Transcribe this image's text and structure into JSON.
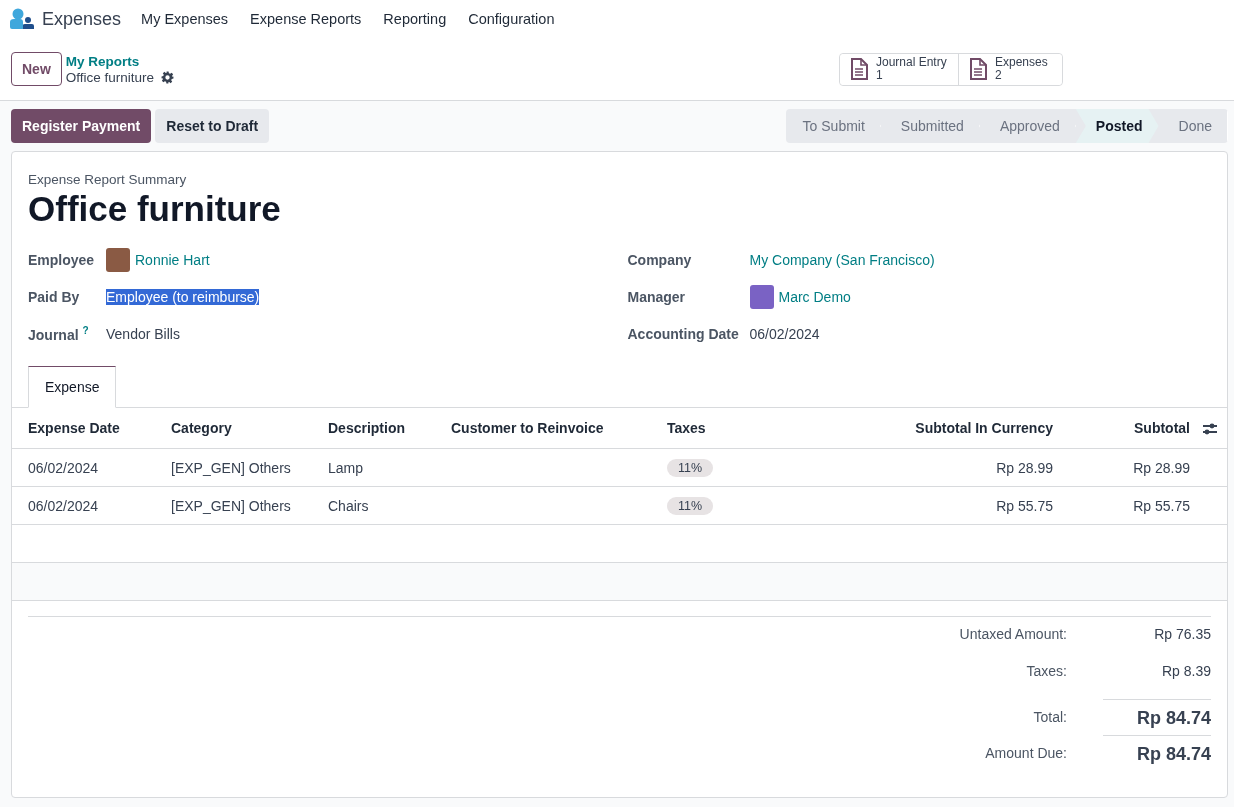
{
  "app": {
    "name": "Expenses"
  },
  "menu": [
    "My Expenses",
    "Expense Reports",
    "Reporting",
    "Configuration"
  ],
  "new_button": "New",
  "breadcrumb": {
    "parent": "My Reports",
    "current": "Office furniture"
  },
  "smart_buttons": [
    {
      "label": "Journal Entry",
      "count": "1"
    },
    {
      "label": "Expenses",
      "count": "2"
    }
  ],
  "actions": [
    {
      "label": "Register Payment",
      "primary": true
    },
    {
      "label": "Reset to Draft",
      "primary": false
    }
  ],
  "stages": [
    {
      "label": "To Submit",
      "selected": false
    },
    {
      "label": "Submitted",
      "selected": false
    },
    {
      "label": "Approved",
      "selected": false
    },
    {
      "label": "Posted",
      "selected": true
    },
    {
      "label": "Done",
      "selected": false
    }
  ],
  "form": {
    "subtitle": "Expense Report Summary",
    "title": "Office furniture",
    "fields_left": [
      {
        "label": "Employee",
        "value": "Ronnie Hart",
        "kind": "avatar-link"
      },
      {
        "label": "Paid By",
        "value": "Employee (to reimburse)",
        "kind": "selected-text"
      },
      {
        "label": "Journal",
        "value": "Vendor Bills",
        "kind": "text",
        "help": "?"
      }
    ],
    "fields_right": [
      {
        "label": "Company",
        "value": "My Company (San Francisco)",
        "kind": "link"
      },
      {
        "label": "Manager",
        "value": "Marc Demo",
        "kind": "avatar-link"
      },
      {
        "label": "Accounting Date",
        "value": "06/02/2024",
        "kind": "text"
      }
    ]
  },
  "tabs": [
    {
      "label": "Expense",
      "selected": true
    }
  ],
  "table": {
    "columns": [
      "Expense Date",
      "Category",
      "Description",
      "Customer to Reinvoice",
      "Taxes",
      "Subtotal In Currency",
      "Subtotal"
    ],
    "rows": [
      {
        "expense_date": "06/02/2024",
        "category": "[EXP_GEN] Others",
        "description": "Lamp",
        "taxes": "11%",
        "subtotal_in_currency": "Rp 28.99",
        "subtotal": "Rp 28.99"
      },
      {
        "expense_date": "06/02/2024",
        "category": "[EXP_GEN] Others",
        "description": "Chairs",
        "taxes": "11%",
        "subtotal_in_currency": "Rp 55.75",
        "subtotal": "Rp 55.75"
      }
    ]
  },
  "totals": [
    {
      "label": "Untaxed Amount:",
      "value": "Rp 76.35",
      "kind": "plain"
    },
    {
      "label": "Taxes:",
      "value": "Rp 8.39",
      "kind": "plain"
    },
    {
      "label": "Total:",
      "value": "Rp 84.74",
      "kind": "grand"
    },
    {
      "label": "Amount Due:",
      "value": "Rp 84.74",
      "kind": "grand"
    }
  ]
}
